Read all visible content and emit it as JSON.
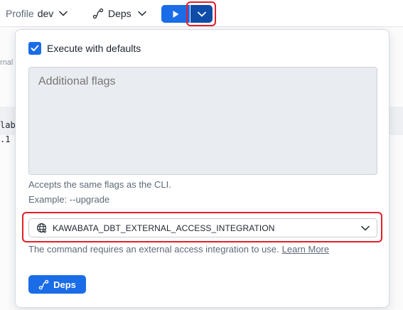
{
  "toolbar": {
    "profile_label": "Profile",
    "profile_value": "dev",
    "deps_label": "Deps"
  },
  "background": {
    "side_text": "rnal",
    "code_line_1": "lab",
    "code_line_2": ".1"
  },
  "popover": {
    "execute_defaults_label": "Execute with defaults",
    "execute_defaults_checked": true,
    "flags_placeholder": "Additional flags",
    "flags_value": "",
    "hint_line_1": "Accepts the same flags as the CLI.",
    "hint_line_2": "Example: --upgrade",
    "integration_selected": "KAWABATA_DBT_EXTERNAL_ACCESS_INTEGRATION",
    "requirement_text": "The command requires an external access integration to use.",
    "learn_more_label": "Learn More",
    "deps_button_label": "Deps"
  },
  "colors": {
    "primary": "#1a6ce7",
    "primary_dark": "#0e4ca8",
    "highlight": "#e31e2a"
  },
  "icons": {
    "run": "play-icon",
    "dropdown": "chevron-down-icon",
    "deps": "dependency-icon",
    "integration": "globe-network-icon",
    "checkbox": "checkmark-icon"
  }
}
